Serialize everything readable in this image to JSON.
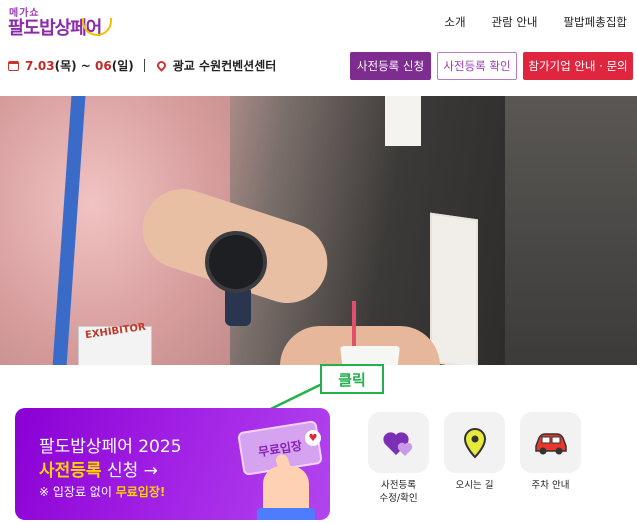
{
  "header": {
    "logo_small": "메가쇼",
    "logo_main": "팔도밥상페어",
    "nav": [
      "소개",
      "관람 안내",
      "팔밥페총집합"
    ]
  },
  "event": {
    "date_prefix": "7.",
    "date_start": "03",
    "date_start_day": "(목) ~ ",
    "date_end": "06",
    "date_end_day": "(일)",
    "location": "광교 수원컨벤션센터"
  },
  "buttons": {
    "register": "사전등록 신청",
    "check": "사전등록 확인",
    "exhibitor": "참가기업 안내 · 문의"
  },
  "hero": {
    "badge_text": "EXHIBITOR"
  },
  "callout": {
    "label": "클릭",
    "color": "#22b14c"
  },
  "banner": {
    "line1": "팔도밥상페어 2025",
    "line2_highlight": "사전등록",
    "line2_rest": " 신청 →",
    "line3_prefix": "※ 입장료 없이 ",
    "line3_highlight": "무료입장!",
    "ticket_text": "무료입장"
  },
  "quick_links": [
    {
      "label_line1": "사전등록",
      "label_line2": "수정/확인",
      "icon": "hearts-icon"
    },
    {
      "label_line1": "오시는 길",
      "label_line2": "",
      "icon": "map-pin-icon"
    },
    {
      "label_line1": "주차 안내",
      "label_line2": "",
      "icon": "car-icon"
    }
  ],
  "colors": {
    "brand_purple": "#7e2c8f",
    "exhibitor_red": "#e0253f",
    "banner_purple": "#8a00d4",
    "highlight_yellow": "#ffd400"
  }
}
